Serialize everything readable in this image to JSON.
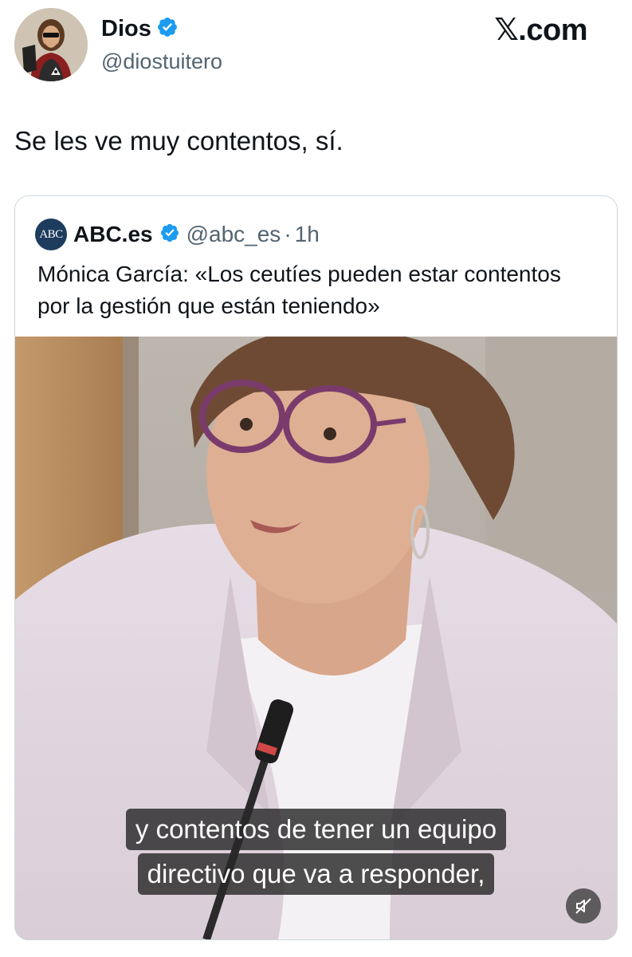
{
  "author": {
    "name": "Dios",
    "handle": "@diostuitero",
    "avatar_icon": "jesus-portrait-avatar",
    "verified_color": "#1d9bf0"
  },
  "brand": {
    "logo_text": "𝕏.com"
  },
  "tweet": {
    "text": "Se les ve muy contentos, sí."
  },
  "quote": {
    "avatar_text": "ABC",
    "name": "ABC.es",
    "handle": "@abc_es",
    "separator": "·",
    "time": "1h",
    "text": "Mónica García: «Los ceutíes pueden estar contentos por la gestión que están teniendo»",
    "media": {
      "subtitle_line1": "y contentos de tener un equipo",
      "subtitle_line2": "directivo que va a responder,",
      "mute_icon": "speaker-muted-icon"
    }
  }
}
